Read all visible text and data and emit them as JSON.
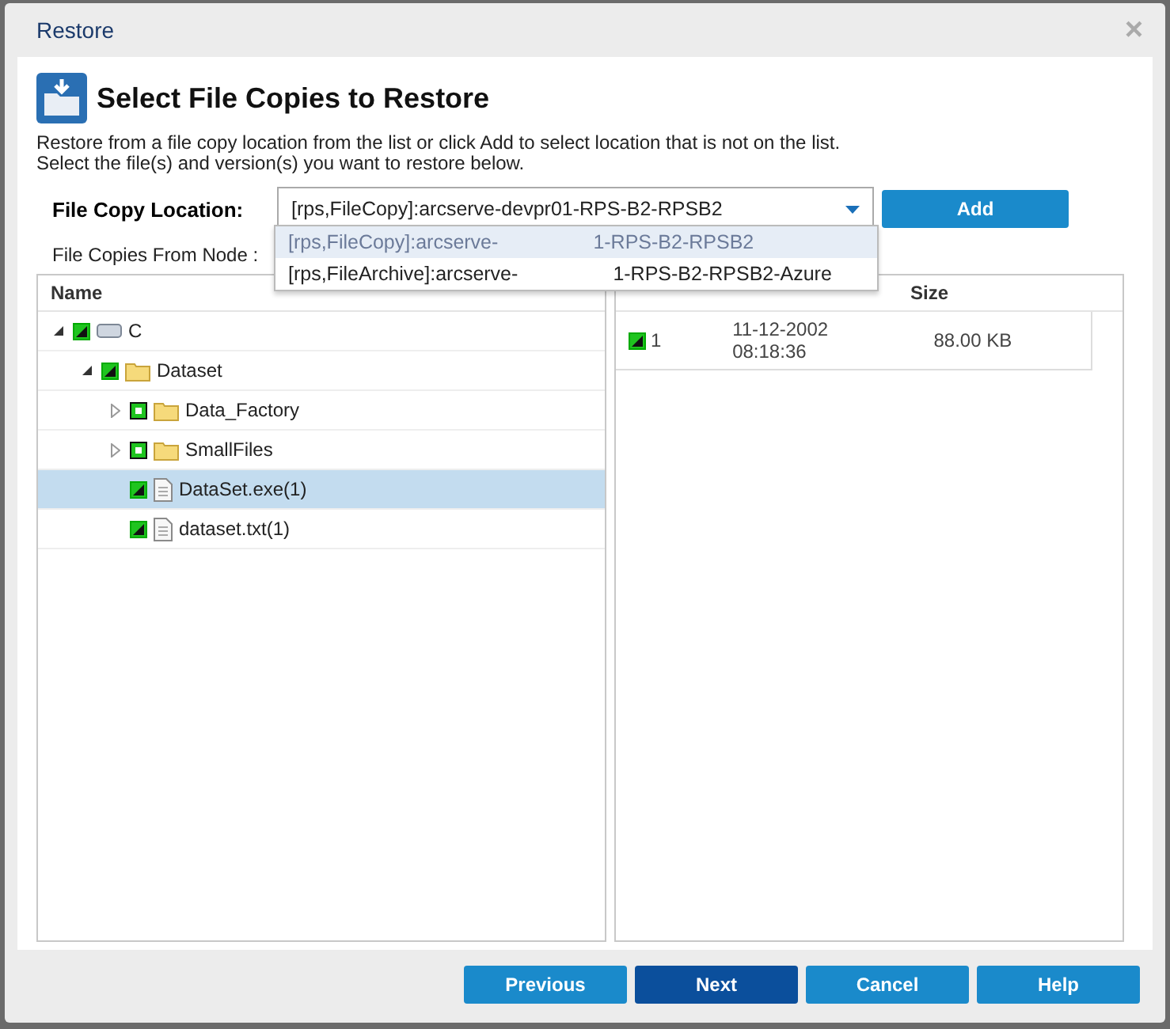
{
  "window": {
    "title": "Restore",
    "close": "×"
  },
  "header": {
    "title": "Select File Copies to Restore",
    "lines": [
      "Restore from a file copy location from the list or click Add to select location that is not on the list.",
      "Select the file(s) and version(s) you want to restore below."
    ]
  },
  "location": {
    "label": "File Copy Location:",
    "value": "[rps,FileCopy]:arcserve-devpr01-RPS-B2-RPSB2",
    "expanded": true,
    "add": "Add",
    "options": [
      {
        "start": "[rps,FileCopy]:arcserve-",
        "end": "1-RPS-B2-RPSB2",
        "selected": true
      },
      {
        "start": "[rps,FileArchive]:arcserve-",
        "end": "1-RPS-B2-RPSB2-Azure",
        "selected": false
      }
    ]
  },
  "node_label": "File Copies From Node :",
  "tree": {
    "column": "Name",
    "items": [
      {
        "name": "C",
        "kind": "drive",
        "checked": true,
        "partial": false,
        "expanded": true,
        "selected": false,
        "children": [
          {
            "name": "Dataset",
            "kind": "folder",
            "checked": true,
            "partial": false,
            "expanded": true,
            "selected": false,
            "children": [
              {
                "name": "Data_Factory",
                "kind": "folder",
                "checked": true,
                "partial": true,
                "expanded": false,
                "selected": false
              },
              {
                "name": "SmallFiles",
                "kind": "folder",
                "checked": true,
                "partial": true,
                "expanded": false,
                "selected": false
              },
              {
                "name": "DataSet.exe(1)",
                "kind": "file",
                "checked": true,
                "partial": false,
                "selected": true
              },
              {
                "name": "dataset.txt(1)",
                "kind": "file",
                "checked": true,
                "partial": false,
                "selected": false
              }
            ]
          }
        ]
      }
    ]
  },
  "versions": {
    "columns": [
      "Size"
    ],
    "rows": [
      {
        "version": "1",
        "date": [
          "11-12-2002",
          "08:18:36"
        ],
        "size": "88.00 KB",
        "checked": true
      }
    ]
  },
  "buttons": [
    {
      "label": "Previous",
      "primary": false
    },
    {
      "label": "Next",
      "primary": true
    },
    {
      "label": "Cancel",
      "primary": false
    },
    {
      "label": "Help",
      "primary": false
    }
  ]
}
